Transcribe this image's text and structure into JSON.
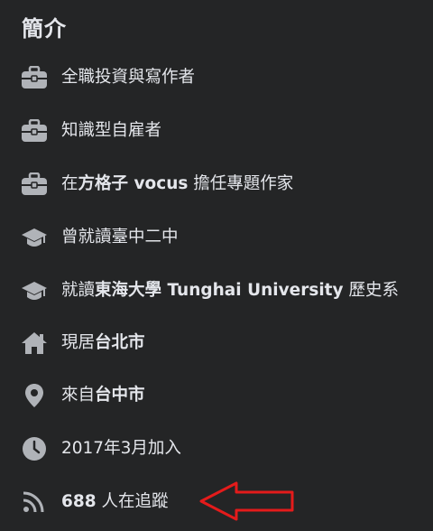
{
  "intro": {
    "title": "簡介",
    "items": [
      {
        "icon": "briefcase-icon",
        "parts": [
          {
            "t": "全職投資與寫作者",
            "b": false
          }
        ]
      },
      {
        "icon": "briefcase-icon",
        "parts": [
          {
            "t": "知識型自雇者",
            "b": false
          }
        ]
      },
      {
        "icon": "briefcase-icon",
        "parts": [
          {
            "t": "在",
            "b": false
          },
          {
            "t": "方格子 vocus",
            "b": true
          },
          {
            "t": " 擔任專題作家",
            "b": false
          }
        ]
      },
      {
        "icon": "graduation-cap-icon",
        "parts": [
          {
            "t": "曾就讀臺中二中",
            "b": false
          }
        ]
      },
      {
        "icon": "graduation-cap-icon",
        "parts": [
          {
            "t": "就讀",
            "b": false
          },
          {
            "t": "東海大學 Tunghai University",
            "b": true
          },
          {
            "t": " 歷史系",
            "b": false
          }
        ]
      },
      {
        "icon": "home-icon",
        "parts": [
          {
            "t": "現居",
            "b": false
          },
          {
            "t": "台北市",
            "b": true
          }
        ]
      },
      {
        "icon": "location-pin-icon",
        "parts": [
          {
            "t": "來自",
            "b": false
          },
          {
            "t": "台中市",
            "b": true
          }
        ]
      },
      {
        "icon": "clock-icon",
        "parts": [
          {
            "t": "2017年3月加入",
            "b": false
          }
        ]
      },
      {
        "icon": "rss-followers-icon",
        "parts": [
          {
            "t": "688",
            "b": true
          },
          {
            "t": " 人在追蹤",
            "b": false
          }
        ]
      }
    ]
  },
  "colors": {
    "background": "#242526",
    "text": "#e4e6eb",
    "icon": "#b0b3b8",
    "annotation_arrow": "#e41b1b"
  }
}
